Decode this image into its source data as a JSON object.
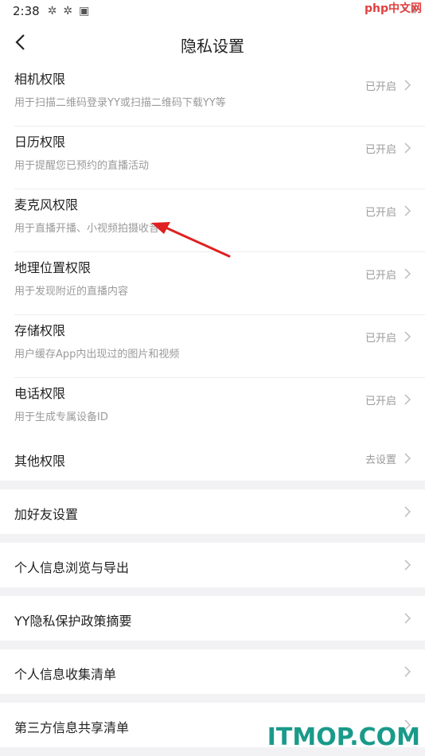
{
  "status_bar": {
    "time": "2:38"
  },
  "header": {
    "title": "隐私设置"
  },
  "permissions": [
    {
      "title": "相机权限",
      "desc": "用于扫描二维码登录YY或扫描二维码下载YY等",
      "status": "已开启"
    },
    {
      "title": "日历权限",
      "desc": "用于提醒您已预约的直播活动",
      "status": "已开启"
    },
    {
      "title": "麦克风权限",
      "desc": "用于直播开播、小视频拍摄收音",
      "status": "已开启"
    },
    {
      "title": "地理位置权限",
      "desc": "用于发现附近的直播内容",
      "status": "已开启"
    },
    {
      "title": "存储权限",
      "desc": "用户缓存App内出现过的图片和视频",
      "status": "已开启"
    },
    {
      "title": "电话权限",
      "desc": "用于生成专属设备ID",
      "status": "已开启"
    }
  ],
  "other": {
    "label": "其他权限",
    "status": "去设置"
  },
  "menu_items": [
    {
      "label": "加好友设置"
    },
    {
      "label": "个人信息浏览与导出"
    },
    {
      "label": "YY隐私保护政策摘要"
    },
    {
      "label": "个人信息收集清单"
    },
    {
      "label": "第三方信息共享清单"
    }
  ],
  "watermarks": {
    "top": "php中文网",
    "bottom": "ITMOP.COM"
  },
  "colors": {
    "annotation_arrow": "#e02020",
    "watermark_bottom": "#1a9a8a"
  }
}
